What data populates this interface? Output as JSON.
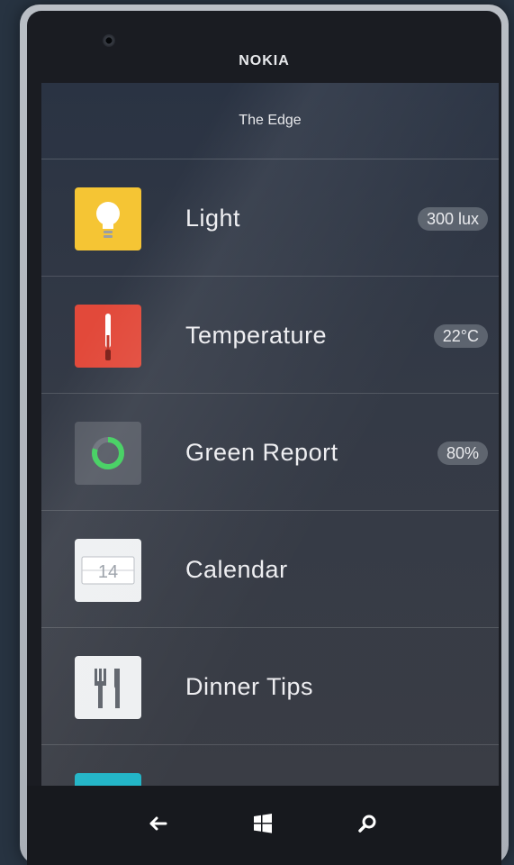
{
  "device": {
    "brand": "NOKIA",
    "camera_icon": "front-camera-icon"
  },
  "app": {
    "title": "The Edge"
  },
  "items": [
    {
      "label": "Light",
      "value": "300 lux",
      "icon": "lightbulb-icon",
      "color": "#f5c534"
    },
    {
      "label": "Temperature",
      "value": "22°C",
      "icon": "thermometer-icon",
      "color": "#e2493a"
    },
    {
      "label": "Green Report",
      "value": "80%",
      "icon": "ring-progress-icon",
      "color": "#535862"
    },
    {
      "label": "Calendar",
      "value": "",
      "icon": "calendar-icon",
      "icon_text": "14",
      "color": "#eef0f2"
    },
    {
      "label": "Dinner Tips",
      "value": "",
      "icon": "fork-knife-icon",
      "color": "#eef0f2"
    },
    {
      "label": "",
      "value": "",
      "icon": "partial-tile-icon",
      "color": "#21b5c7"
    }
  ],
  "nav": {
    "back_icon": "back-arrow-icon",
    "home_icon": "windows-logo-icon",
    "search_icon": "search-icon"
  }
}
